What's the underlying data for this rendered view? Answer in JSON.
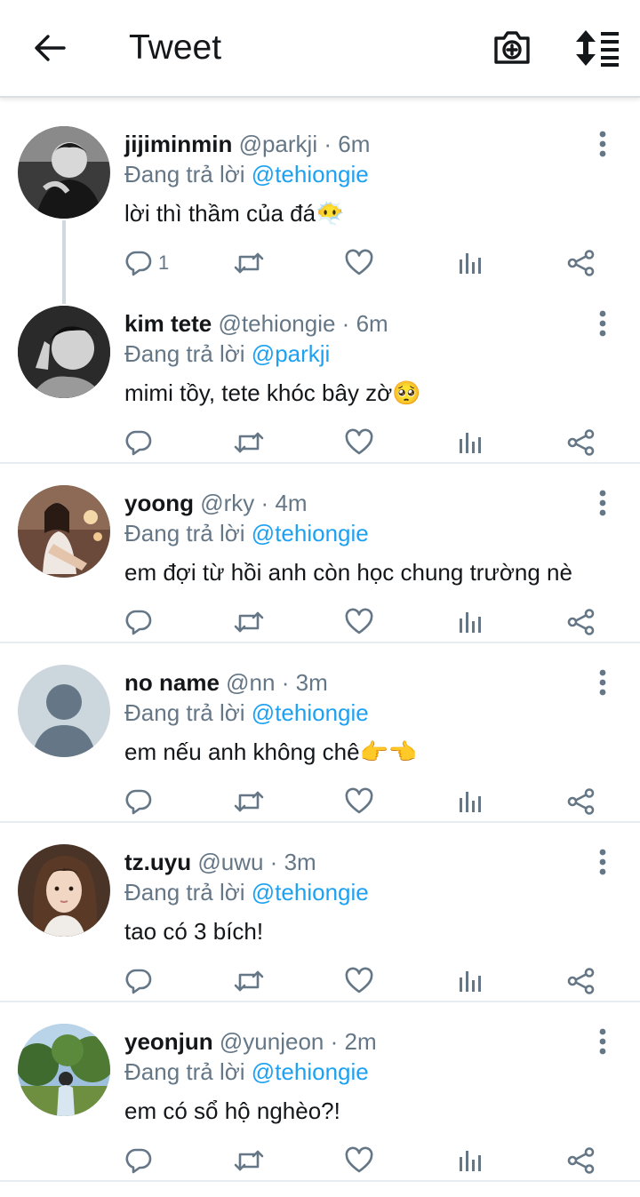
{
  "header": {
    "title": "Tweet",
    "back_icon": "arrow-left-icon",
    "camera_icon": "camera-add-icon",
    "sort_icon": "sort-list-icon"
  },
  "colors": {
    "accent": "#1da1f2",
    "muted": "#657786",
    "text": "#14171a",
    "divider": "#e6ecf0"
  },
  "tweets": [
    {
      "name": "jijiminmin",
      "handle": "@parkji",
      "dot": "·",
      "time": "6m",
      "reply_prefix": "Đang trả lời",
      "reply_to": "@tehiongie",
      "text": "lời thì thầm của đá😶‍🌫️",
      "reply_count": "1"
    },
    {
      "name": "kim tete",
      "handle": "@tehiongie",
      "dot": "·",
      "time": "6m",
      "reply_prefix": "Đang trả lời",
      "reply_to": "@parkji",
      "text": "mimi tồy, tete khóc bây zờ🥺",
      "reply_count": ""
    },
    {
      "name": "yoong",
      "handle": "@rky",
      "dot": "·",
      "time": "4m",
      "reply_prefix": "Đang trả lời",
      "reply_to": "@tehiongie",
      "text": "em đợi từ hồi anh còn học chung trường nè",
      "reply_count": ""
    },
    {
      "name": "no name",
      "handle": "@nn",
      "dot": "·",
      "time": "3m",
      "reply_prefix": "Đang trả lời",
      "reply_to": "@tehiongie",
      "text": "em nếu anh không chê👉👈",
      "reply_count": ""
    },
    {
      "name": "tz.uyu",
      "handle": "@uwu",
      "dot": "·",
      "time": "3m",
      "reply_prefix": "Đang trả lời",
      "reply_to": "@tehiongie",
      "text": "tao có 3 bích!",
      "reply_count": ""
    },
    {
      "name": "yeonjun",
      "handle": "@yunjeon",
      "dot": "·",
      "time": "2m",
      "reply_prefix": "Đang trả lời",
      "reply_to": "@tehiongie",
      "text": "em có sổ hộ nghèo?!",
      "reply_count": ""
    }
  ]
}
